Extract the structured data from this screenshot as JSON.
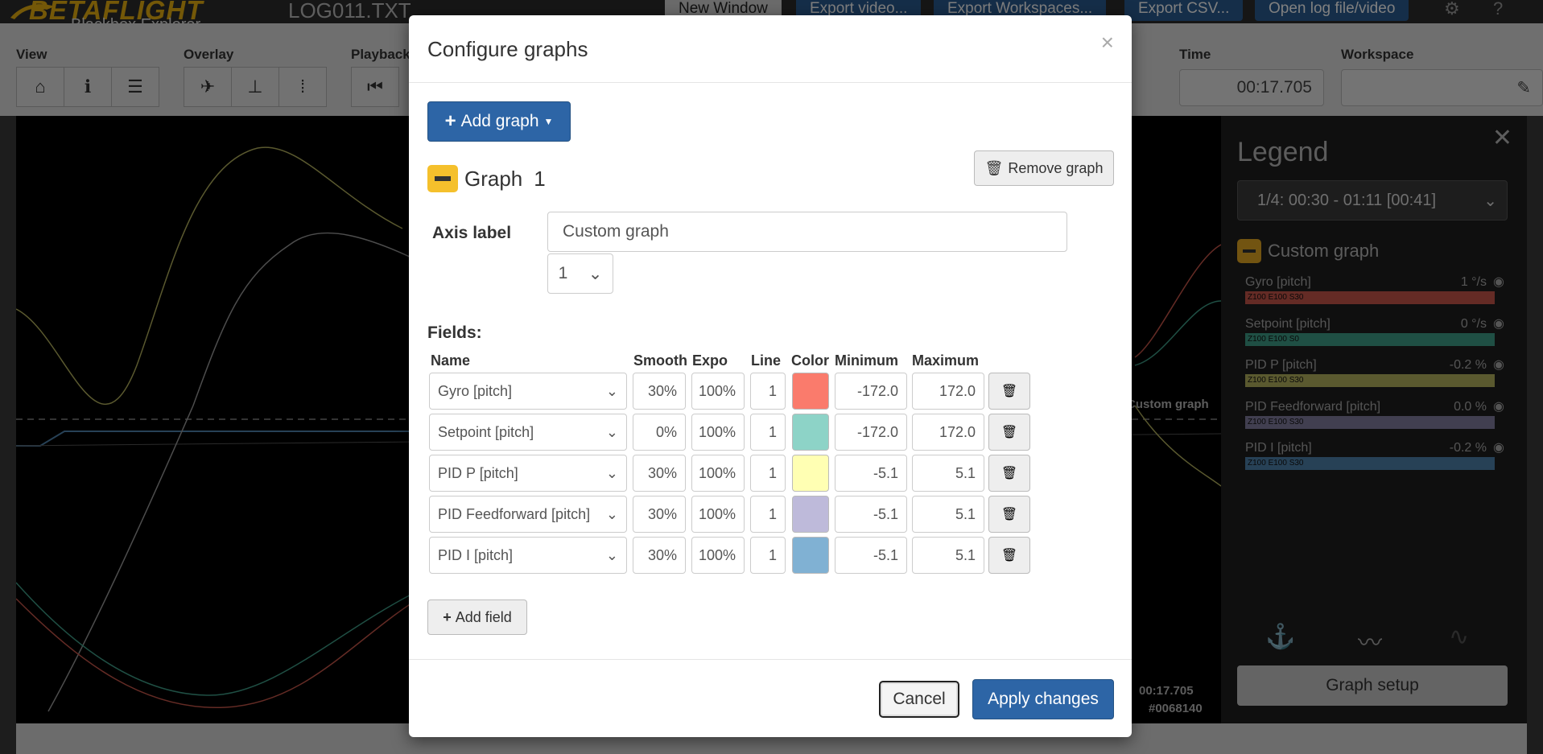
{
  "app": {
    "brand": "BETAFLIGHT",
    "brand_sub": "Blackbox Explorer",
    "filename": "LOG011.TXT"
  },
  "topbar": {
    "new_window": "New Window",
    "export_video": "Export video...",
    "export_workspaces": "Export Workspaces...",
    "export_csv": "Export CSV...",
    "open_log": "Open log file/video"
  },
  "toolbar": {
    "view_label": "View",
    "overlay_label": "Overlay",
    "playback_label": "Playback",
    "time_label": "Time",
    "time_value": "00:17.705",
    "workspace_label": "Workspace"
  },
  "graph_area": {
    "time_stamp": "00:17.705",
    "frame_stamp": "#0068140",
    "graph_label": "Custom graph"
  },
  "legend": {
    "title": "Legend",
    "selection": "1/4: 00:30 - 01:11 [00:41]",
    "group": "Custom graph",
    "entries": [
      {
        "name": "Gyro [pitch]",
        "value": "1 °/s",
        "bar": "Z100 E100 S30",
        "color": "#c9574a"
      },
      {
        "name": "Setpoint [pitch]",
        "value": "0 °/s",
        "bar": "Z100 E100 S0",
        "color": "#3f9e88"
      },
      {
        "name": "PID P [pitch]",
        "value": "-0.2 %",
        "bar": "Z100 E100 S30",
        "color": "#b5b25e"
      },
      {
        "name": "PID Feedforward [pitch]",
        "value": "0.0 %",
        "bar": "Z100 E100 S30",
        "color": "#837fa0"
      },
      {
        "name": "PID I [pitch]",
        "value": "-0.2 %",
        "bar": "Z100 E100 S30",
        "color": "#4f82ac"
      }
    ],
    "graph_setup": "Graph setup"
  },
  "modal": {
    "title": "Configure graphs",
    "add_graph": "Add graph",
    "graph_title": "Graph",
    "graph_number": "1",
    "remove_graph": "Remove graph",
    "axis_label": "Axis label",
    "axis_value": "Custom graph",
    "axis_select": "1",
    "fields_label": "Fields:",
    "columns": {
      "name": "Name",
      "smooth": "Smooth",
      "expo": "Expo",
      "line": "Line",
      "color": "Color",
      "minimum": "Minimum",
      "maximum": "Maximum"
    },
    "fields": [
      {
        "name": "Gyro [pitch]",
        "smooth": "30%",
        "expo": "100%",
        "line": "1",
        "color": "#fa7b6c",
        "min": "-172.0",
        "max": "172.0"
      },
      {
        "name": "Setpoint [pitch]",
        "smooth": "0%",
        "expo": "100%",
        "line": "1",
        "color": "#8dd3c7",
        "min": "-172.0",
        "max": "172.0"
      },
      {
        "name": "PID P [pitch]",
        "smooth": "30%",
        "expo": "100%",
        "line": "1",
        "color": "#ffffb3",
        "min": "-5.1",
        "max": "5.1"
      },
      {
        "name": "PID Feedforward [pitch]",
        "smooth": "30%",
        "expo": "100%",
        "line": "1",
        "color": "#bebada",
        "min": "-5.1",
        "max": "5.1"
      },
      {
        "name": "PID I [pitch]",
        "smooth": "30%",
        "expo": "100%",
        "line": "1",
        "color": "#80b1d3",
        "min": "-5.1",
        "max": "5.1"
      }
    ],
    "add_field": "Add field",
    "cancel": "Cancel",
    "apply": "Apply changes"
  }
}
